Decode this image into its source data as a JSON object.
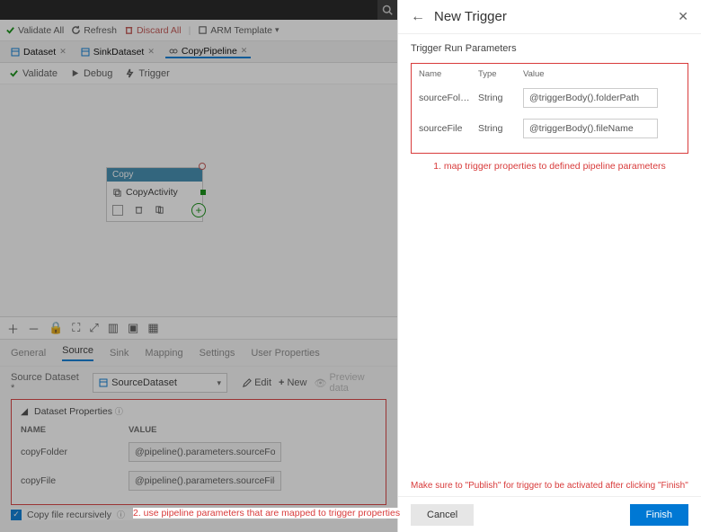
{
  "toolbar": {
    "validate_all": "Validate All",
    "refresh": "Refresh",
    "discard_all": "Discard All",
    "arm_template": "ARM Template"
  },
  "tabs": {
    "t1": "Dataset",
    "t2": "SinkDataset",
    "t3": "CopyPipeline"
  },
  "pipeline_toolbar": {
    "validate": "Validate",
    "debug": "Debug",
    "trigger": "Trigger"
  },
  "node": {
    "head": "Copy",
    "label": "CopyActivity"
  },
  "bottom_tabs": {
    "general": "General",
    "source": "Source",
    "sink": "Sink",
    "mapping": "Mapping",
    "settings": "Settings",
    "user_props": "User Properties"
  },
  "source_row": {
    "label": "Source Dataset *",
    "value": "SourceDataset",
    "edit": "Edit",
    "new": "New",
    "preview": "Preview data"
  },
  "dataset_props": {
    "title": "Dataset Properties",
    "col_name": "NAME",
    "col_value": "VALUE",
    "row1_name": "copyFolder",
    "row1_value": "@pipeline().parameters.sourceFolder",
    "row2_name": "copyFile",
    "row2_value": "@pipeline().parameters.sourceFile"
  },
  "recursive": {
    "label": "Copy file recursively"
  },
  "annotation2": "2. use pipeline parameters that are mapped to trigger properties",
  "panel": {
    "title": "New Trigger",
    "subtitle": "Trigger Run Parameters",
    "col_name": "Name",
    "col_type": "Type",
    "col_value": "Value",
    "r1_name": "sourceFol…",
    "r1_type": "String",
    "r1_value": "@triggerBody().folderPath",
    "r2_name": "sourceFile",
    "r2_type": "String",
    "r2_value": "@triggerBody().fileName",
    "annotation1": "1. map trigger properties to defined pipeline parameters",
    "note": "Make sure to \"Publish\" for trigger to be activated after clicking \"Finish\"",
    "cancel": "Cancel",
    "finish": "Finish"
  }
}
